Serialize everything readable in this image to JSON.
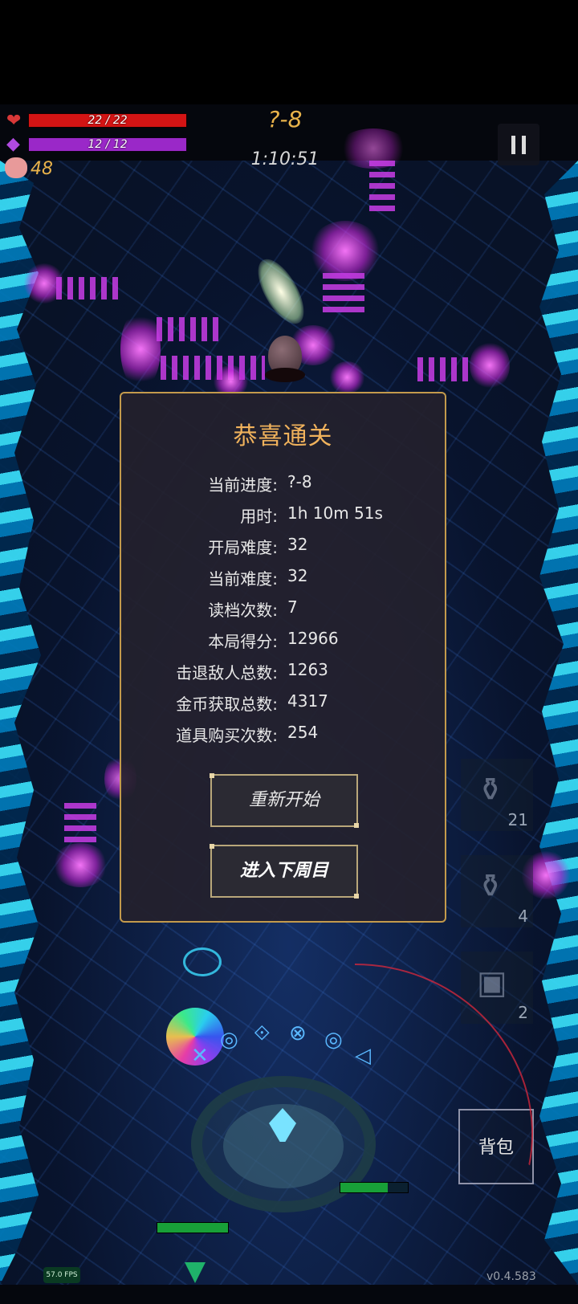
{
  "hud": {
    "hp": {
      "current": 22,
      "max": 22,
      "text": "22 / 22",
      "color": "#d41414",
      "icon": "heart-icon"
    },
    "mp": {
      "current": 12,
      "max": 12,
      "text": "12 / 12",
      "color": "#9a28c8",
      "icon": "mana-crystal-icon"
    },
    "gold": {
      "value": "48",
      "icon": "pig-icon",
      "color": "#e8b24a"
    },
    "stage": "?-8",
    "timer": "1:10:51",
    "pause_icon": "pause-icon"
  },
  "dialog": {
    "title": "恭喜通关",
    "stats": [
      {
        "label": "当前进度:",
        "value": "?-8"
      },
      {
        "label": "用时:",
        "value": "1h 10m 51s"
      },
      {
        "label": "开局难度:",
        "value": "32"
      },
      {
        "label": "当前难度:",
        "value": "32"
      },
      {
        "label": "读档次数:",
        "value": "7"
      },
      {
        "label": "本局得分:",
        "value": "12966"
      },
      {
        "label": "击退敌人总数:",
        "value": "1263"
      },
      {
        "label": "金币获取总数:",
        "value": "4317"
      },
      {
        "label": "道具购买次数:",
        "value": "254"
      }
    ],
    "restart_label": "重新开始",
    "next_cycle_label": "进入下周目"
  },
  "inventory": {
    "slots": [
      {
        "icon": "potion-icon",
        "count": "21"
      },
      {
        "icon": "potion-icon",
        "count": "4"
      },
      {
        "icon": "crate-icon",
        "count": "2"
      }
    ],
    "bag_label": "背包"
  },
  "footer": {
    "fps": "57.0 FPS",
    "version": "v0.4.583"
  },
  "colors": {
    "accent_gold": "#f0b25c",
    "dialog_border": "#c39a4c",
    "dialog_bg": "#24212c"
  }
}
